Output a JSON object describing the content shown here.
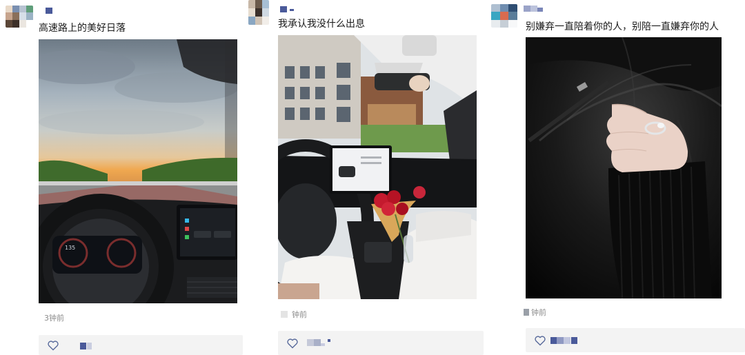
{
  "posts": [
    {
      "caption": "高速路上的美好日落",
      "time": "3钟前",
      "photo_subject": "car-dashboard-sunset",
      "speed_readout": "135"
    },
    {
      "caption": "我承认我没什么出息",
      "time": "钟前",
      "photo_subject": "car-interior-roses"
    },
    {
      "caption": "别嫌弃一直陪着你的人，别陪一直嫌弃你的人",
      "time": "钟前",
      "photo_subject": "black-leather-hand-ring"
    }
  ],
  "icons": {
    "like": "heart-outline-icon"
  },
  "colors": {
    "like_bar_bg": "#f3f3f3",
    "time_text": "#8c8c8c",
    "name_mosaic": "#4a5a9a"
  }
}
